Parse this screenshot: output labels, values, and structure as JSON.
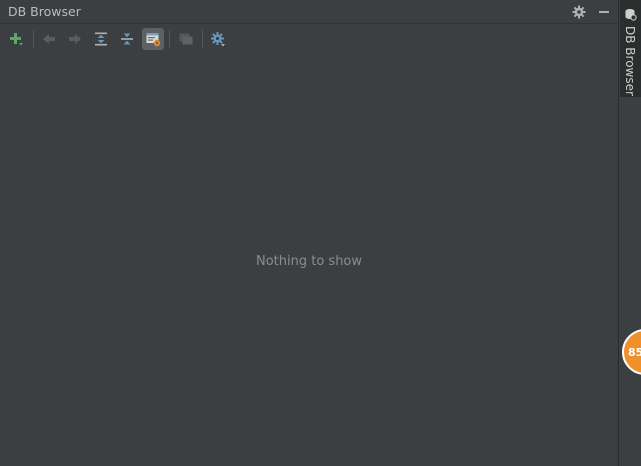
{
  "panel": {
    "title": "DB Browser"
  },
  "header": {
    "icons": [
      "gear-icon",
      "minimize-icon"
    ]
  },
  "toolbar": {
    "buttons": [
      {
        "name": "add-connection-button",
        "icon": "plus-icon",
        "color": "#59a869"
      },
      {
        "name": "navigate-back-button",
        "icon": "arrow-left-icon",
        "enabled": false
      },
      {
        "name": "navigate-forward-button",
        "icon": "arrow-right-icon",
        "enabled": false
      },
      {
        "name": "expand-all-button",
        "icon": "expand-all-icon",
        "color": "#6897bb"
      },
      {
        "name": "collapse-all-button",
        "icon": "collapse-all-icon",
        "color": "#6897bb"
      },
      {
        "name": "show-object-properties-button",
        "icon": "properties-icon",
        "active": true
      },
      {
        "name": "open-sql-console-button",
        "icon": "console-icon",
        "enabled": false
      },
      {
        "name": "settings-button",
        "icon": "settings-gear-icon",
        "color": "#6897bb"
      }
    ]
  },
  "content": {
    "empty_text": "Nothing to show"
  },
  "side_tab": {
    "label": "DB Browser"
  },
  "badge": {
    "text": "85"
  }
}
